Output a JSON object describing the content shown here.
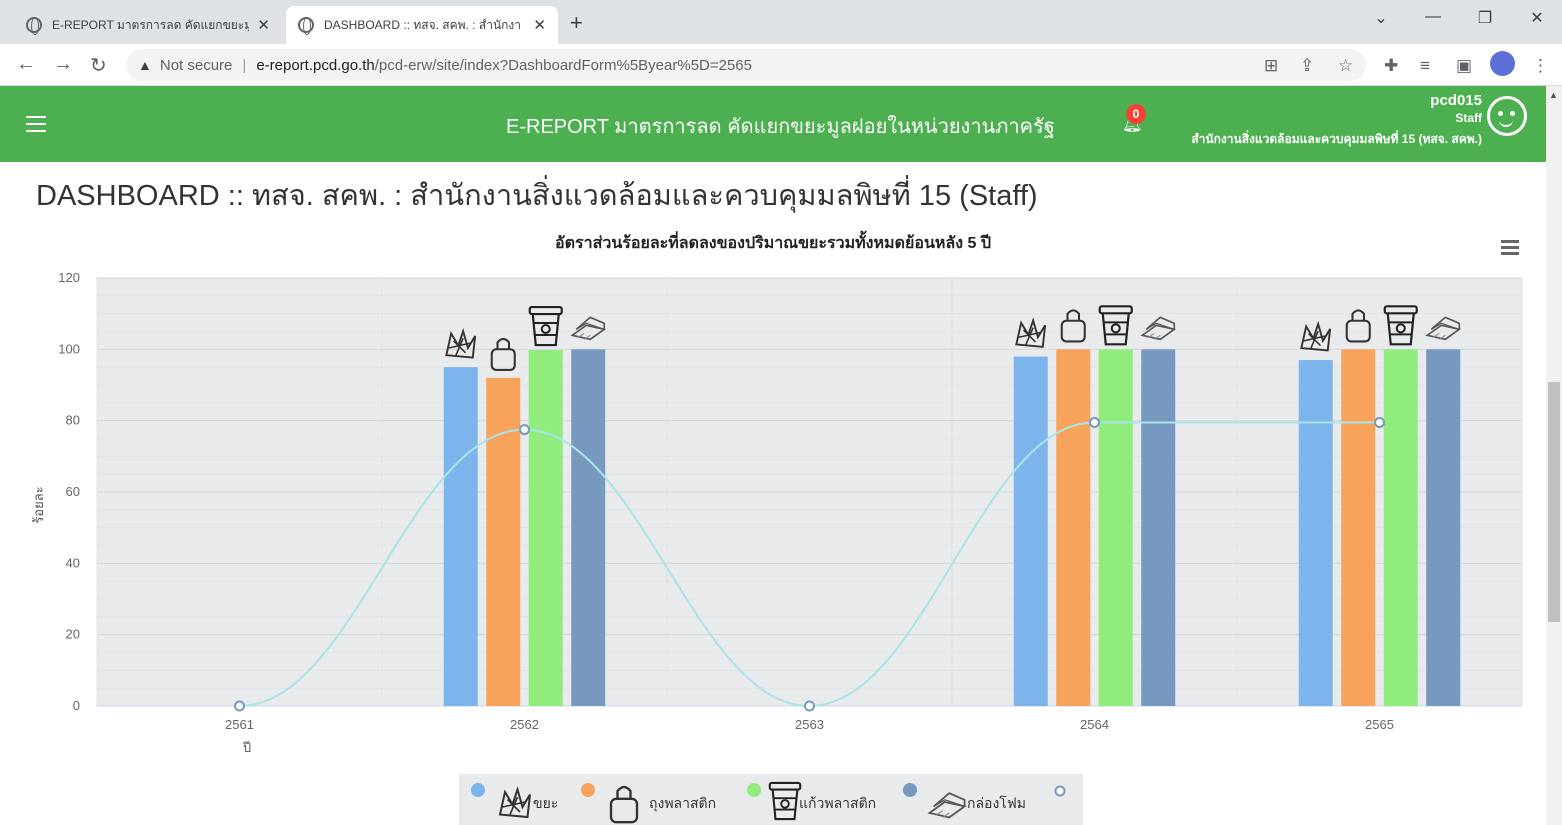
{
  "browser": {
    "tabs": [
      {
        "title": "E-REPORT มาตรการลด คัดแยกขยะมู",
        "active": false
      },
      {
        "title": "DASHBOARD :: ทสจ. สคพ. : สำนักงา",
        "active": true
      }
    ],
    "new_tab": "+",
    "address": {
      "security": "Not secure",
      "host": "e-report.pcd.go.th",
      "path": "/pcd-erw/site/index?DashboardForm%5Byear%5D=2565"
    }
  },
  "header": {
    "app_title": "E-REPORT มาตรการลด คัดแยกขยะมูลฝอยในหน่วยงานภาครัฐ",
    "notification_count": "0",
    "username": "pcd015",
    "role": "Staff",
    "office": "สำนักงานสิ่งแวดล้อมและควบคุมมลพิษที่ 15 (ทสจ. สคพ.)"
  },
  "page_title": "DASHBOARD :: ทสจ. สคพ. : สำนักงานสิ่งแวดล้อมและควบคุมมลพิษที่ 15 (Staff)",
  "colors": {
    "series1": "#7cb5ec",
    "series2": "#f7a35c",
    "series3": "#90ed7d",
    "series4": "#7798bf",
    "line": "#a8e4e8",
    "header_green": "#4caf50",
    "plot_bg": "#e8eaec"
  },
  "chart_data": {
    "type": "bar",
    "title": "อัตราส่วนร้อยละที่ลดลงของปริมาณขยะรวมทั้งหมดย้อนหลัง 5 ปี",
    "xlabel": "ปี",
    "ylabel": "ร้อยละ",
    "ylim": [
      0,
      120
    ],
    "yticks": [
      0,
      20,
      40,
      60,
      80,
      100,
      120
    ],
    "categories": [
      "2561",
      "2562",
      "2563",
      "2564",
      "2565"
    ],
    "series": [
      {
        "name": "ขยะ",
        "icon": "garbage-icon",
        "values": [
          0,
          95,
          0,
          98,
          97
        ]
      },
      {
        "name": "ถุงพลาสติก",
        "icon": "plastic-bag-icon",
        "values": [
          0,
          92,
          0,
          100,
          100
        ]
      },
      {
        "name": "แก้วพลาสติก",
        "icon": "plastic-cup-icon",
        "values": [
          0,
          99.8,
          0,
          100,
          100
        ]
      },
      {
        "name": "กล่องโฟม",
        "icon": "foam-box-icon",
        "values": [
          0,
          100,
          0,
          100,
          100
        ]
      },
      {
        "name": "",
        "type": "spline",
        "values": [
          0,
          77.5,
          0,
          79.5,
          79.5
        ]
      }
    ],
    "grid": true,
    "legend": "bottom-center"
  }
}
